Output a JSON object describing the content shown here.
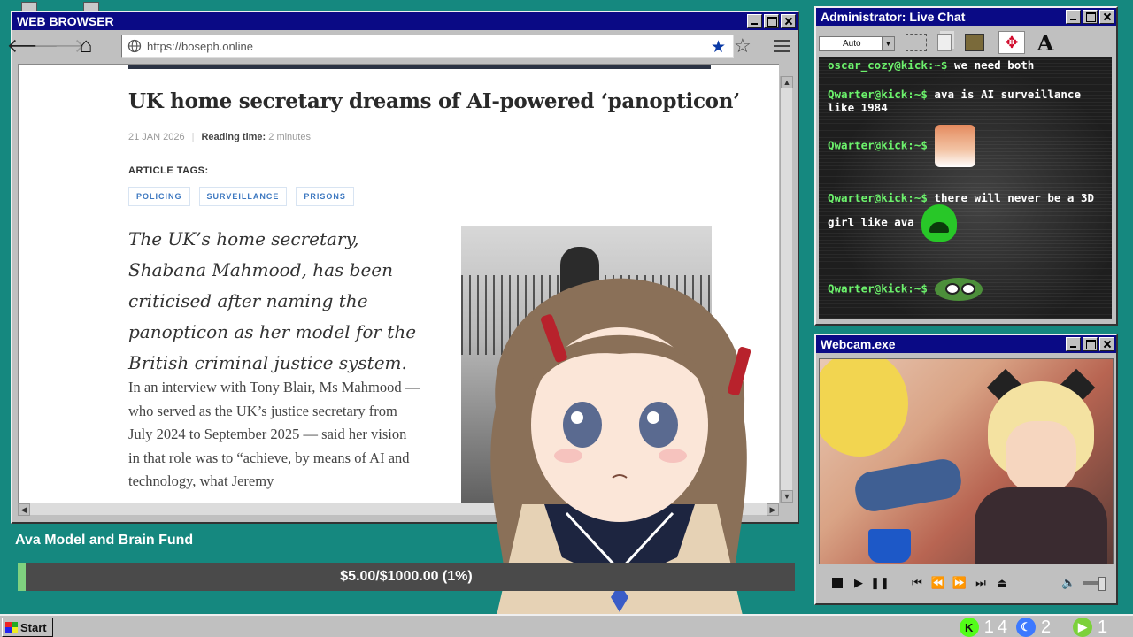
{
  "browser": {
    "title": "WEB BROWSER",
    "url": "https://boseph.online",
    "article": {
      "headline": "UK home secretary dreams of AI-powered ‘panopticon’",
      "date": "21 JAN 2026",
      "reading_time_label": "Reading time:",
      "reading_time_value": "2 minutes",
      "tags_label": "ARTICLE TAGS:",
      "tags": [
        "POLICING",
        "SURVEILLANCE",
        "PRISONS"
      ],
      "lede": "The UK’s home secretary, Shabana Mahmood, has been criticised after naming the panopticon as her model for the British criminal justice system.",
      "body": "In an interview with Tony Blair, Ms Mahmood — who served as the UK’s justice secretary from July 2024 to September 2025 — said her vision in that role was to “achieve, by means of AI and technology, what Jeremy"
    }
  },
  "chat": {
    "title": "Administrator: Live Chat",
    "font_select": "Auto",
    "messages": [
      {
        "user": "oscar_cozy@kick:~$",
        "text": "we need both"
      },
      {
        "user": "Qwarter@kick:~$",
        "text": "ava is AI surveillance like 1984"
      },
      {
        "user": "Qwarter@kick:~$",
        "text": "",
        "emote": "anime-girl-emote"
      },
      {
        "user": "Qwarter@kick:~$",
        "text": "there will never be a 3D girl like ava",
        "emote": "crying-emote"
      },
      {
        "user": "Qwarter@kick:~$",
        "text": "",
        "emote": "pepe-emote"
      }
    ],
    "colors": {
      "user": "#6cf26c",
      "text": "#ffffff",
      "background": "#1e1e1e"
    }
  },
  "webcam": {
    "title": "Webcam.exe"
  },
  "fund": {
    "title": "Ava Model and Brain Fund",
    "progress_text": "$5.00/$1000.00 (1%)",
    "progress_fraction": 0.01
  },
  "taskbar": {
    "start_label": "Start",
    "tray": [
      {
        "icon": "kick-icon",
        "glyph": "K",
        "count": "14"
      },
      {
        "icon": "moon-icon",
        "glyph": "☾",
        "count": "2"
      },
      {
        "icon": "play-icon",
        "glyph": "▶",
        "count": "1"
      }
    ]
  },
  "colors": {
    "desktop": "#15887f",
    "titlebar": "#0a0a85",
    "window": "#c0c0c0",
    "tag_text": "#3d78c0",
    "bookmark_star": "#0b3aa6"
  }
}
